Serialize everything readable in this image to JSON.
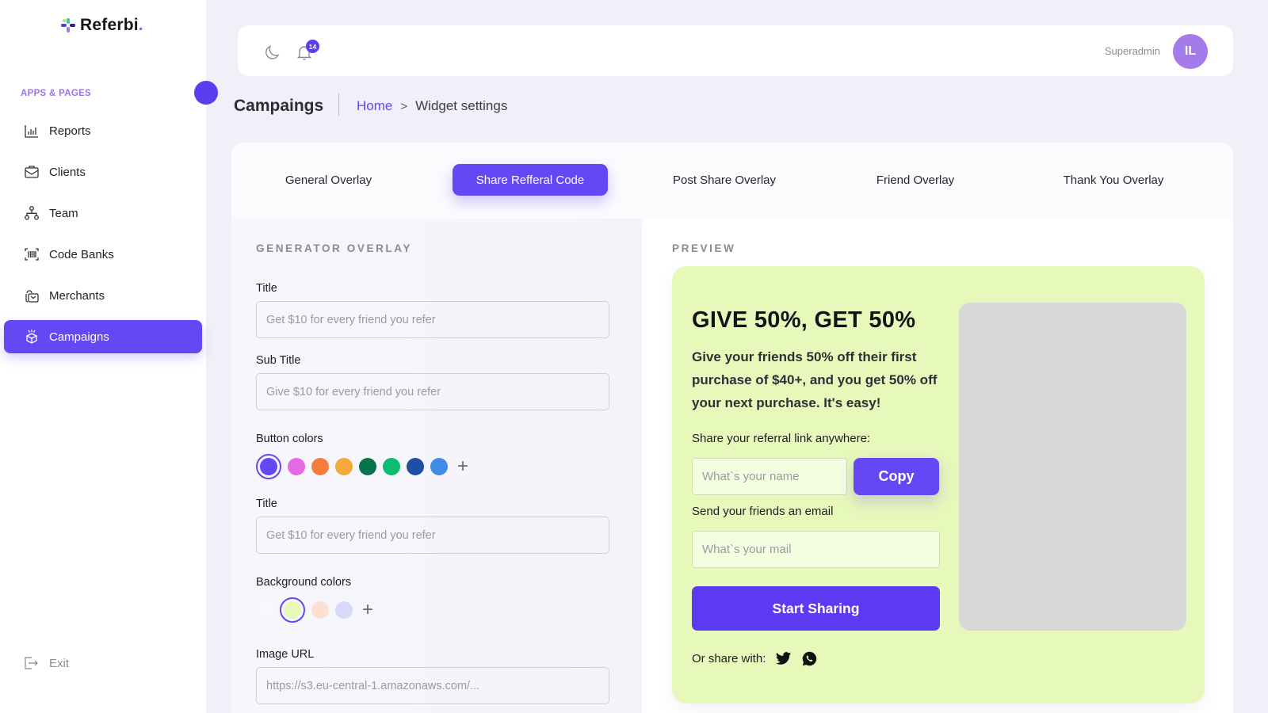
{
  "brand": {
    "name": "Referbi",
    "dot": "."
  },
  "sidebar": {
    "section_label": "APPS & PAGES",
    "items": [
      {
        "label": "Reports",
        "icon": "bar-chart-icon",
        "active": false
      },
      {
        "label": "Clients",
        "icon": "briefcase-icon",
        "active": false
      },
      {
        "label": "Team",
        "icon": "org-chart-icon",
        "active": false
      },
      {
        "label": "Code Banks",
        "icon": "barcode-icon",
        "active": false
      },
      {
        "label": "Merchants",
        "icon": "shopping-bag-icon",
        "active": false
      },
      {
        "label": "Campaigns",
        "icon": "gift-box-icon",
        "active": true
      }
    ],
    "exit_label": "Exit"
  },
  "topbar": {
    "notification_count": "14",
    "role": "Superadmin",
    "avatar_initials": "IL"
  },
  "header": {
    "page_title": "Campaings",
    "breadcrumb": {
      "home": "Home",
      "separator": ">",
      "current": "Widget settings"
    }
  },
  "tabs": [
    {
      "label": "General Overlay",
      "active": false
    },
    {
      "label": "Share Refferal Code",
      "active": true
    },
    {
      "label": "Post Share Overlay",
      "active": false
    },
    {
      "label": "Friend Overlay",
      "active": false
    },
    {
      "label": "Thank You Overlay",
      "active": false
    }
  ],
  "form": {
    "heading": "GENERATOR OVERLAY",
    "title_label": "Title",
    "title_placeholder": "Get $10 for every friend you refer",
    "subtitle_label": "Sub Title",
    "subtitle_placeholder": "Give $10 for every friend you refer",
    "button_colors_label": "Button colors",
    "button_colors": [
      "#6547f5",
      "#e36ae3",
      "#f57d3b",
      "#f4a93a",
      "#06734a",
      "#0cbc6f",
      "#1f4fa3",
      "#428ce6"
    ],
    "button_color_selected": 0,
    "title2_label": "Title",
    "title2_placeholder": "Get $10 for every friend you refer",
    "background_colors_label": "Background colors",
    "background_colors": [
      "#f5f8fd",
      "#e7f8bb",
      "#fde0d0",
      "#d7d9fa"
    ],
    "background_color_selected": 1,
    "image_url_label": "Image URL",
    "image_url_placeholder": "https://s3.eu-central-1.amazonaws.com/..."
  },
  "preview": {
    "heading": "PREVIEW",
    "title": "GIVE 50%, GET 50%",
    "description": "Give your friends 50% off their first purchase of $40+, and you get 50% off your next purchase. It's easy!",
    "share_link_label": "Share your referral link anywhere:",
    "name_placeholder": "What`s your name",
    "copy_label": "Copy",
    "email_label": "Send your friends an email",
    "mail_placeholder": "What`s your mail",
    "start_label": "Start Sharing",
    "share_with_label": "Or share with:"
  },
  "colors": {
    "accent": "#6547f5",
    "widget_bg": "#e7f8bb",
    "image_placeholder": "#d8d8d8"
  }
}
